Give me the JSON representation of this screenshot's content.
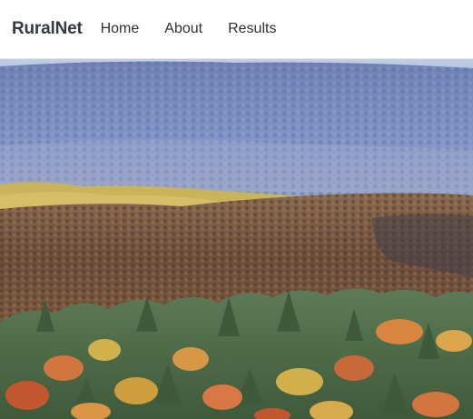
{
  "nav": {
    "brand": "RuralNet",
    "links": [
      "Home",
      "About",
      "Results"
    ]
  },
  "hero": {
    "image": "autumn-forest-hillside-photo",
    "colors": {
      "sky": "#b5c7de",
      "distant_hills": "#7f90c0",
      "mid_ridge_gold": "#c7b25a",
      "mid_ridge_brown": "#7a5a45",
      "foreground_green": "#5f7f55",
      "foreground_orange": "#d27a3f",
      "foreground_yellow": "#d9b54b"
    }
  }
}
